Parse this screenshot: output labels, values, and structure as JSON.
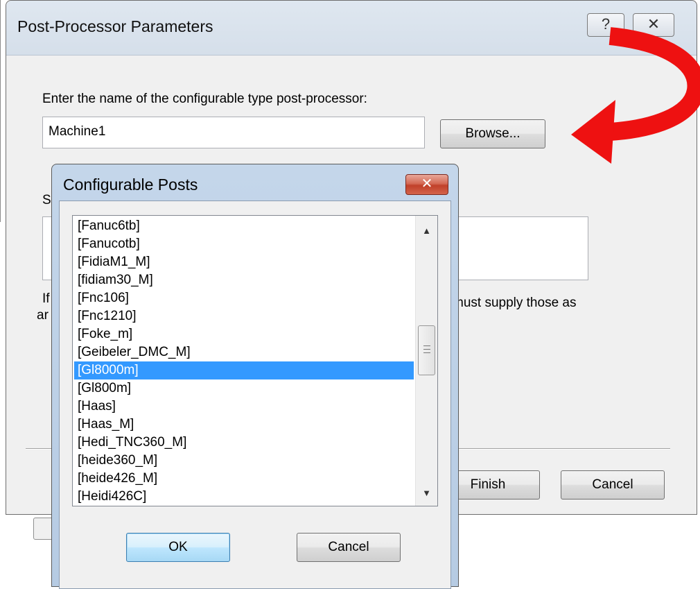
{
  "main_dialog": {
    "title": "Post-Processor Parameters",
    "help_button": "?",
    "close_button": "✕",
    "prompt_label": "Enter the name of the configurable type post-processor:",
    "name_value": "Machine1",
    "browse_label": "Browse...",
    "partial_label_s": "S",
    "partial_text_if": "If",
    "partial_text_ar": "ar",
    "partial_text_must": "must supply those as",
    "finish_label": "Finish",
    "cancel_label": "Cancel"
  },
  "sub_dialog": {
    "title": "Configurable Posts",
    "close_button": "✕",
    "items": [
      "[Fanuc6tb]",
      "[Fanucotb]",
      "[FidiaM1_M]",
      "[fidiam30_M]",
      "[Fnc106]",
      "[Fnc1210]",
      "[Foke_m]",
      "[Geibeler_DMC_M]",
      "[Gl8000m]",
      "[Gl800m]",
      "[Haas]",
      "[Haas_M]",
      "[Hedi_TNC360_M]",
      "[heide360_M]",
      "[heide426_M]",
      "[Heidi426C]"
    ],
    "selected_item": "[Gl8000m]",
    "ok_label": "OK",
    "cancel_label": "Cancel"
  },
  "colors": {
    "selection": "#3399ff",
    "annotation_arrow": "#ee1111"
  },
  "icons": {
    "annotation": "curved-arrow-icon",
    "scroll_up": "scroll-up-arrow-icon",
    "scroll_down": "scroll-down-arrow-icon"
  }
}
